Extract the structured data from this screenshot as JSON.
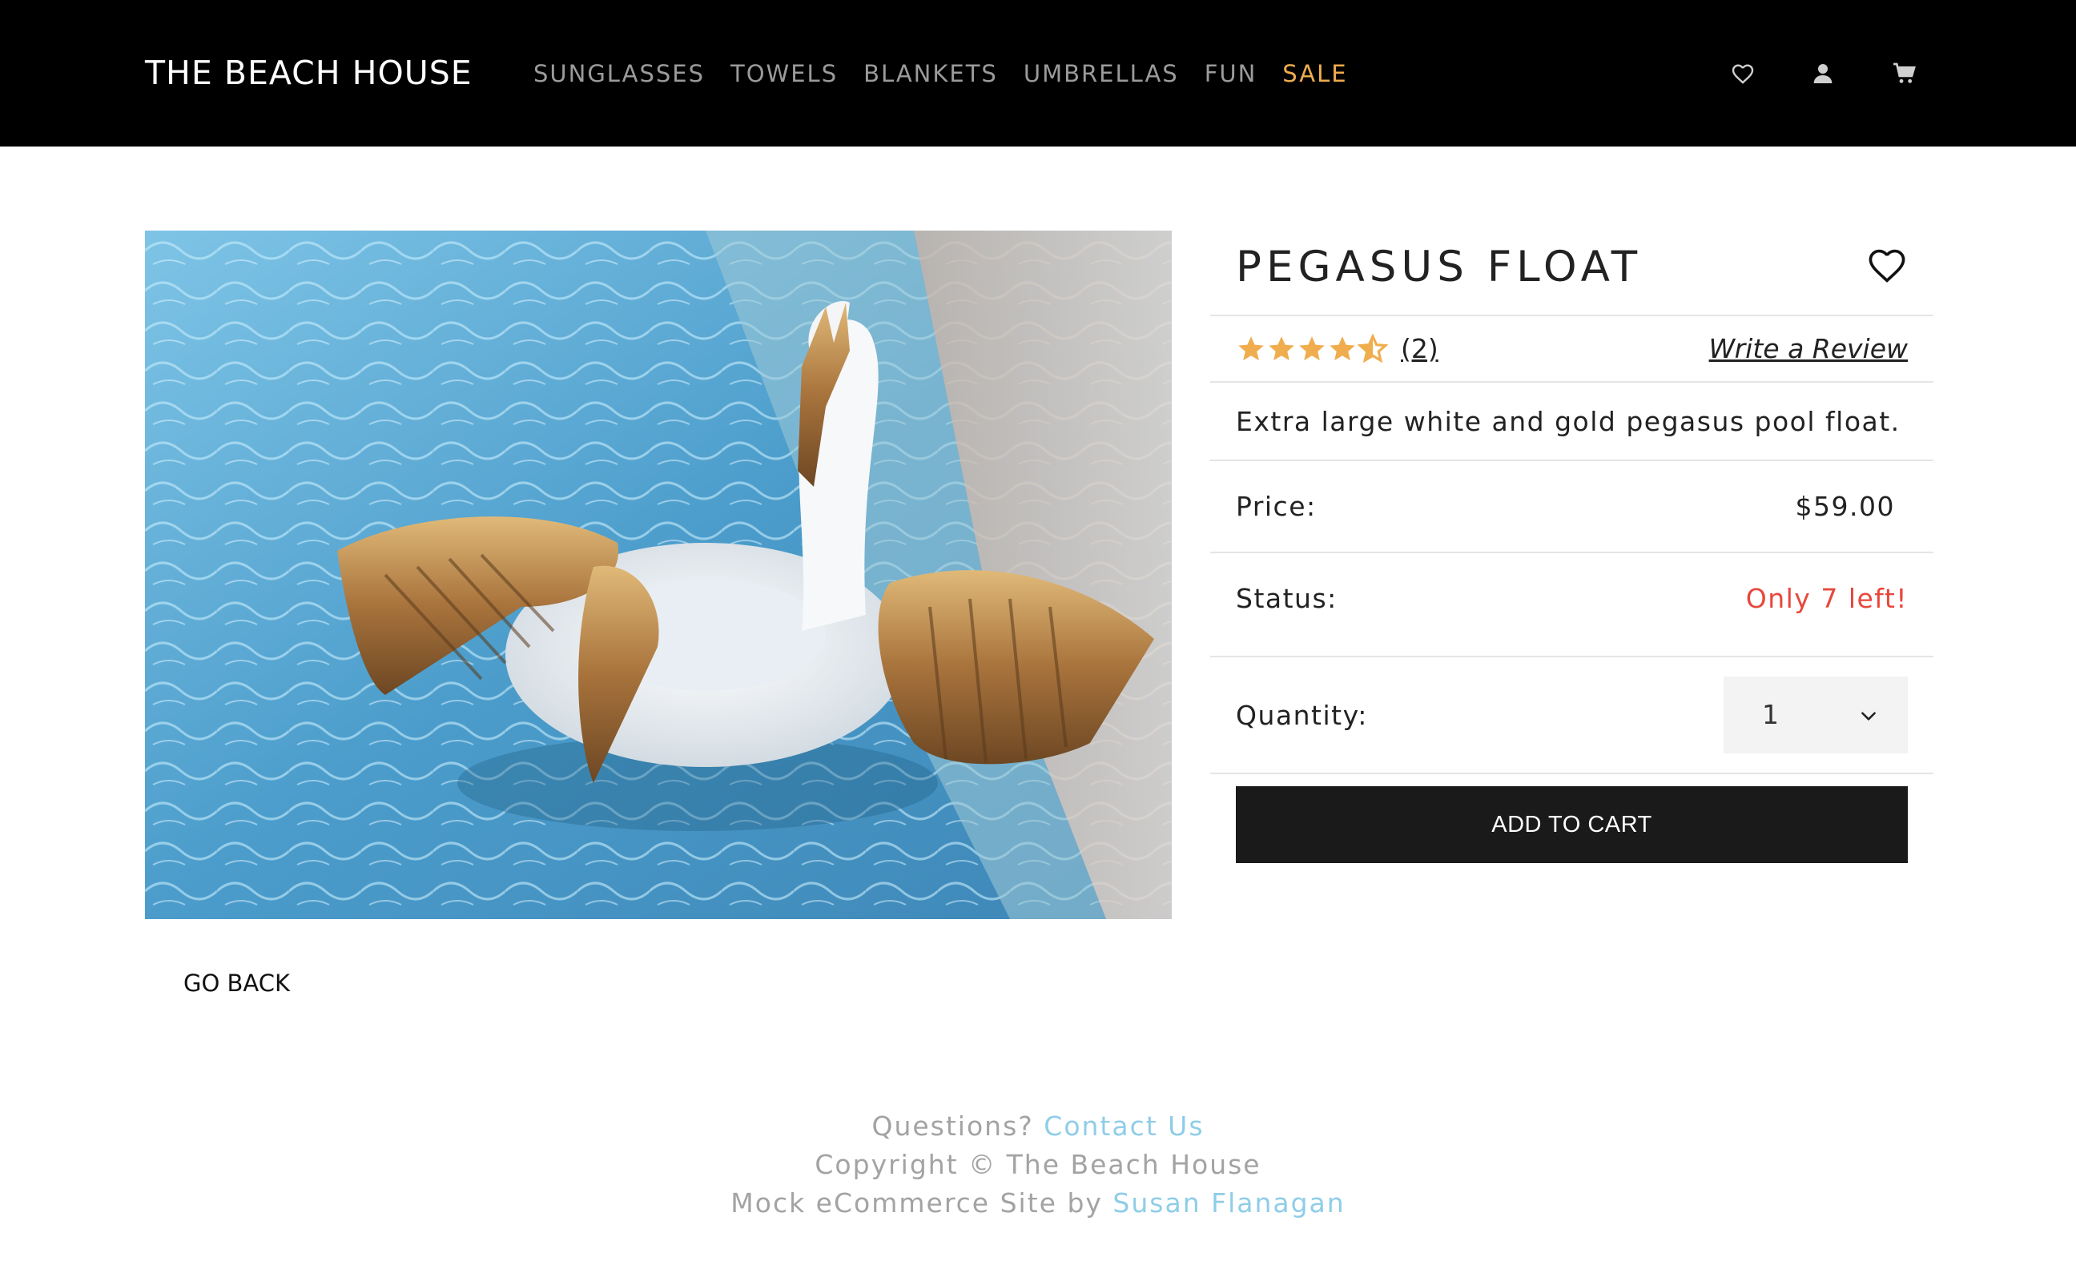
{
  "nav": {
    "brand": "THE BEACH HOUSE",
    "links": [
      "SUNGLASSES",
      "TOWELS",
      "BLANKETS",
      "UMBRELLAS",
      "FUN"
    ],
    "sale_label": "SALE",
    "icons": [
      "heart-icon",
      "user-icon",
      "cart-icon"
    ]
  },
  "product": {
    "title": "PEGASUS FLOAT",
    "rating": 4.5,
    "rating_max": 5,
    "review_count": "(2)",
    "write_review": "Write a Review",
    "description": "Extra large white and gold pegasus pool float.",
    "price_label": "Price:",
    "price_value": "$59.00",
    "status_label": "Status:",
    "status_value": "Only 7 left!",
    "quantity_label": "Quantity:",
    "quantity_value": "1",
    "add_to_cart": "ADD TO CART"
  },
  "go_back": "GO BACK",
  "footer": {
    "questions": "Questions?",
    "contact_link": "Contact Us",
    "copyright": "Copyright © The Beach House",
    "mock_text": "Mock eCommerce Site by",
    "author_link": "Susan Flanagan"
  },
  "colors": {
    "nav_bg": "#000000",
    "sale": "#f0ad4e",
    "star": "#f0ad4e",
    "status_alert": "#e7473c",
    "footer_link": "#8fcde8",
    "button_bg": "#1a1a1a"
  }
}
